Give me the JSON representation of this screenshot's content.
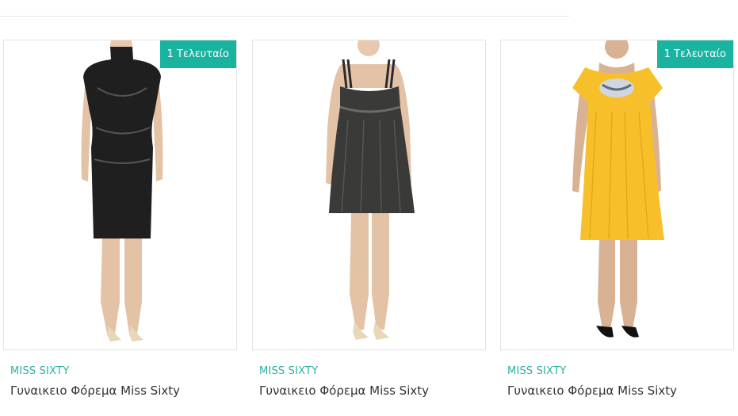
{
  "products": [
    {
      "badge": "1 Τελευταίο",
      "brand": "MISS SIXTY",
      "title": "Γυναικειο Φόρεμα Miss Sixty",
      "dress_color": "#1f1f1f",
      "image": "black-draped-dress-photo"
    },
    {
      "badge": "",
      "brand": "MISS SIXTY",
      "title": "Γυναικειο Φόρεμα Miss Sixty",
      "dress_color": "#3a3a38",
      "image": "metallic-strap-dress-photo"
    },
    {
      "badge": "1 Τελευταίο",
      "brand": "MISS SIXTY",
      "title": "Γυναικειο Φόρεμα Miss Sixty",
      "dress_color": "#f7c02b",
      "image": "yellow-flutter-dress-photo"
    }
  ],
  "colors": {
    "badge_bg": "#1ab3a0",
    "brand_text": "#2ab0a2",
    "title_text": "#333333"
  }
}
